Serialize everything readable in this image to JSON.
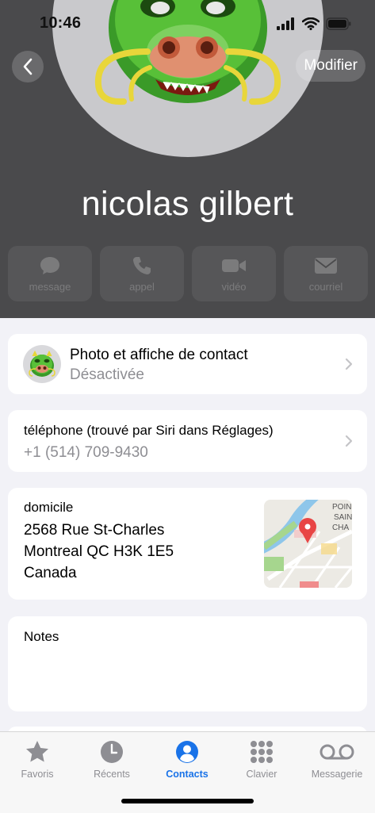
{
  "status_bar": {
    "time": "10:46"
  },
  "header": {
    "edit_label": "Modifier",
    "contact_name": "nicolas gilbert",
    "avatar_icon": "dragon-memoji-icon",
    "background_color": "#4a4a4c"
  },
  "actions": [
    {
      "label": "message",
      "icon": "message-bubble-icon"
    },
    {
      "label": "appel",
      "icon": "phone-icon"
    },
    {
      "label": "vidéo",
      "icon": "video-camera-icon"
    },
    {
      "label": "courriel",
      "icon": "envelope-icon"
    }
  ],
  "poster": {
    "title": "Photo et affiche de contact",
    "status": "Désactivée"
  },
  "phone": {
    "label": "téléphone (trouvé par Siri dans Réglages)",
    "number": "+1 (514) 709-9430"
  },
  "address": {
    "label": "domicile",
    "line1": "2568 Rue St-Charles",
    "line2": "Montreal QC H3K 1E5",
    "line3": "Canada",
    "map_text": [
      "POIN",
      "SAIN",
      "CHA"
    ]
  },
  "notes": {
    "label": "Notes"
  },
  "tabbar": {
    "accent_color": "#1a73e8",
    "items": [
      {
        "label": "Favoris",
        "icon": "star-icon",
        "active": false
      },
      {
        "label": "Récents",
        "icon": "clock-icon",
        "active": false
      },
      {
        "label": "Contacts",
        "icon": "person-circle-icon",
        "active": true
      },
      {
        "label": "Clavier",
        "icon": "keypad-icon",
        "active": false
      },
      {
        "label": "Messagerie",
        "icon": "voicemail-icon",
        "active": false
      }
    ]
  }
}
